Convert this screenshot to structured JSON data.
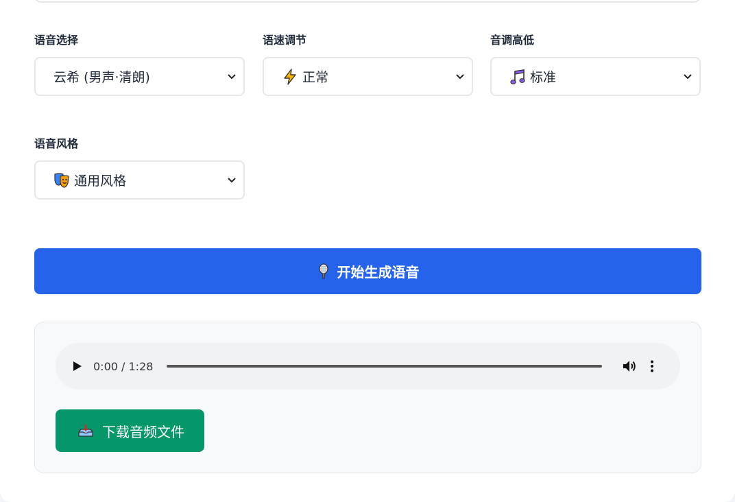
{
  "voice": {
    "label": "语音选择",
    "selected": "云希 (男声·清朗)"
  },
  "speed": {
    "label": "语速调节",
    "selected": "正常",
    "icon": "lightning-icon"
  },
  "pitch": {
    "label": "音调高低",
    "selected": "标准",
    "icon": "music-note-icon"
  },
  "style": {
    "label": "语音风格",
    "selected": "通用风格",
    "icon": "theater-masks-icon"
  },
  "generate_button": {
    "label": "开始生成语音",
    "icon": "microphone-icon",
    "color": "#2563eb"
  },
  "audio": {
    "time": "0:00 / 1:28",
    "progress": 0
  },
  "download_button": {
    "label": "下载音频文件",
    "icon": "inbox-tray-icon",
    "color": "#059669"
  }
}
